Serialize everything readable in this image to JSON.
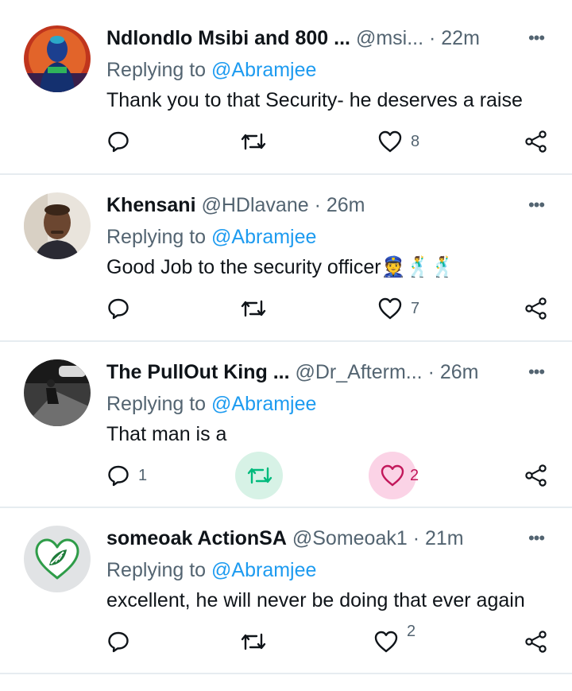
{
  "replying_label": "Replying to",
  "tweets": [
    {
      "name": "Ndlondlo Msibi and 800 ...",
      "handle": "@msi...",
      "sep": " · ",
      "time": "22m",
      "mention": "@Abramjee",
      "text": "Thank you to that Security- he deserves a raise",
      "replies": "",
      "retweets": "",
      "likes": "8"
    },
    {
      "name": "Khensani",
      "handle": "@HDlavane",
      "sep": " · ",
      "time": "26m",
      "mention": "@Abramjee",
      "text": "Good Job to the security officer👮🕺🕺",
      "replies": "",
      "retweets": "",
      "likes": "7"
    },
    {
      "name": "The PullOut King ...",
      "handle": "@Dr_Afterm...",
      "sep": " · ",
      "time": "26m",
      "mention": "@Abramjee",
      "text": "That man is a",
      "replies": "1",
      "retweets": "",
      "likes": "2"
    },
    {
      "name": "someoak ActionSA",
      "handle": "@Someoak1",
      "sep": " · ",
      "time": "21m",
      "mention": "@Abramjee",
      "text": "excellent, he will never be doing that ever again",
      "replies": "",
      "retweets": "",
      "likes": "2"
    }
  ],
  "colors": {
    "link": "#1d9bf0",
    "muted": "#536471",
    "retweet_active": "#00ba7c",
    "like_active": "#f91880",
    "actionsa_green": "#2e9c48"
  }
}
